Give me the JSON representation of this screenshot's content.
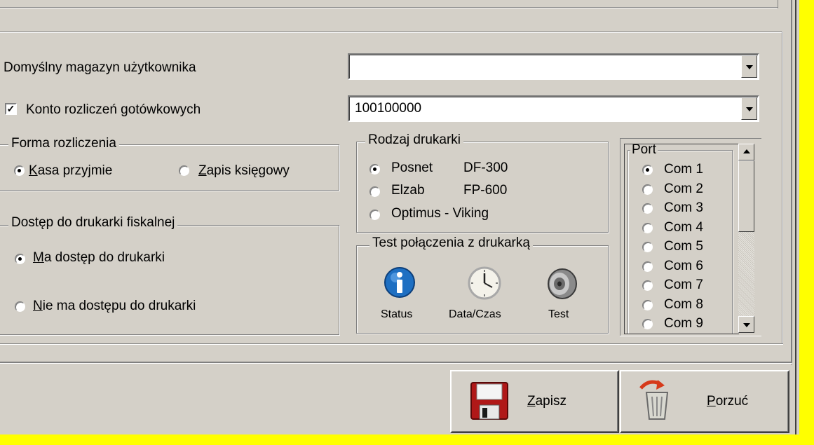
{
  "form": {
    "default_warehouse_label": "Domyślny magazyn użytkownika",
    "default_warehouse_value": "",
    "cash_account_label": "Konto rozliczeń gotówkowych",
    "cash_account_checked": true,
    "cash_account_value": "100100000"
  },
  "settlement": {
    "title": "Forma rozliczenia",
    "options": [
      {
        "mnemonic": "K",
        "rest": "asa przyjmie",
        "selected": true
      },
      {
        "mnemonic": "Z",
        "rest": "apis księgowy",
        "selected": false
      }
    ]
  },
  "fiscal_access": {
    "title": "Dostęp do drukarki fiskalnej",
    "options": [
      {
        "mnemonic": "M",
        "rest": "a dostęp do drukarki",
        "selected": true
      },
      {
        "mnemonic": "N",
        "rest": "ie ma dostępu do drukarki",
        "selected": false
      }
    ]
  },
  "printer_type": {
    "title": "Rodzaj drukarki",
    "options": [
      {
        "name": "Posnet",
        "model": "DF-300",
        "selected": true
      },
      {
        "name": "Elzab",
        "model": "FP-600",
        "selected": false
      },
      {
        "name": "Optimus - Viking",
        "model": "",
        "selected": false
      }
    ]
  },
  "connection_test": {
    "title": "Test połączenia z drukarką",
    "buttons": [
      {
        "label": "Status",
        "icon": "info-icon"
      },
      {
        "label": "Data/Czas",
        "icon": "clock-icon"
      },
      {
        "label": "Test",
        "icon": "speaker-icon"
      }
    ]
  },
  "port": {
    "title": "Port",
    "items": [
      "Com 1",
      "Com 2",
      "Com 3",
      "Com 4",
      "Com 5",
      "Com 6",
      "Com 7",
      "Com 8",
      "Com 9"
    ],
    "selected_index": 0
  },
  "actions": {
    "save_mnemonic": "Z",
    "save_rest": "apisz",
    "discard_mnemonic": "P",
    "discard_rest": "orzuć"
  },
  "colors": {
    "window_bg": "#d4d0c8",
    "outer_bg": "#ffff00",
    "save_icon": "#b01818",
    "info_icon": "#1e6fc2"
  }
}
